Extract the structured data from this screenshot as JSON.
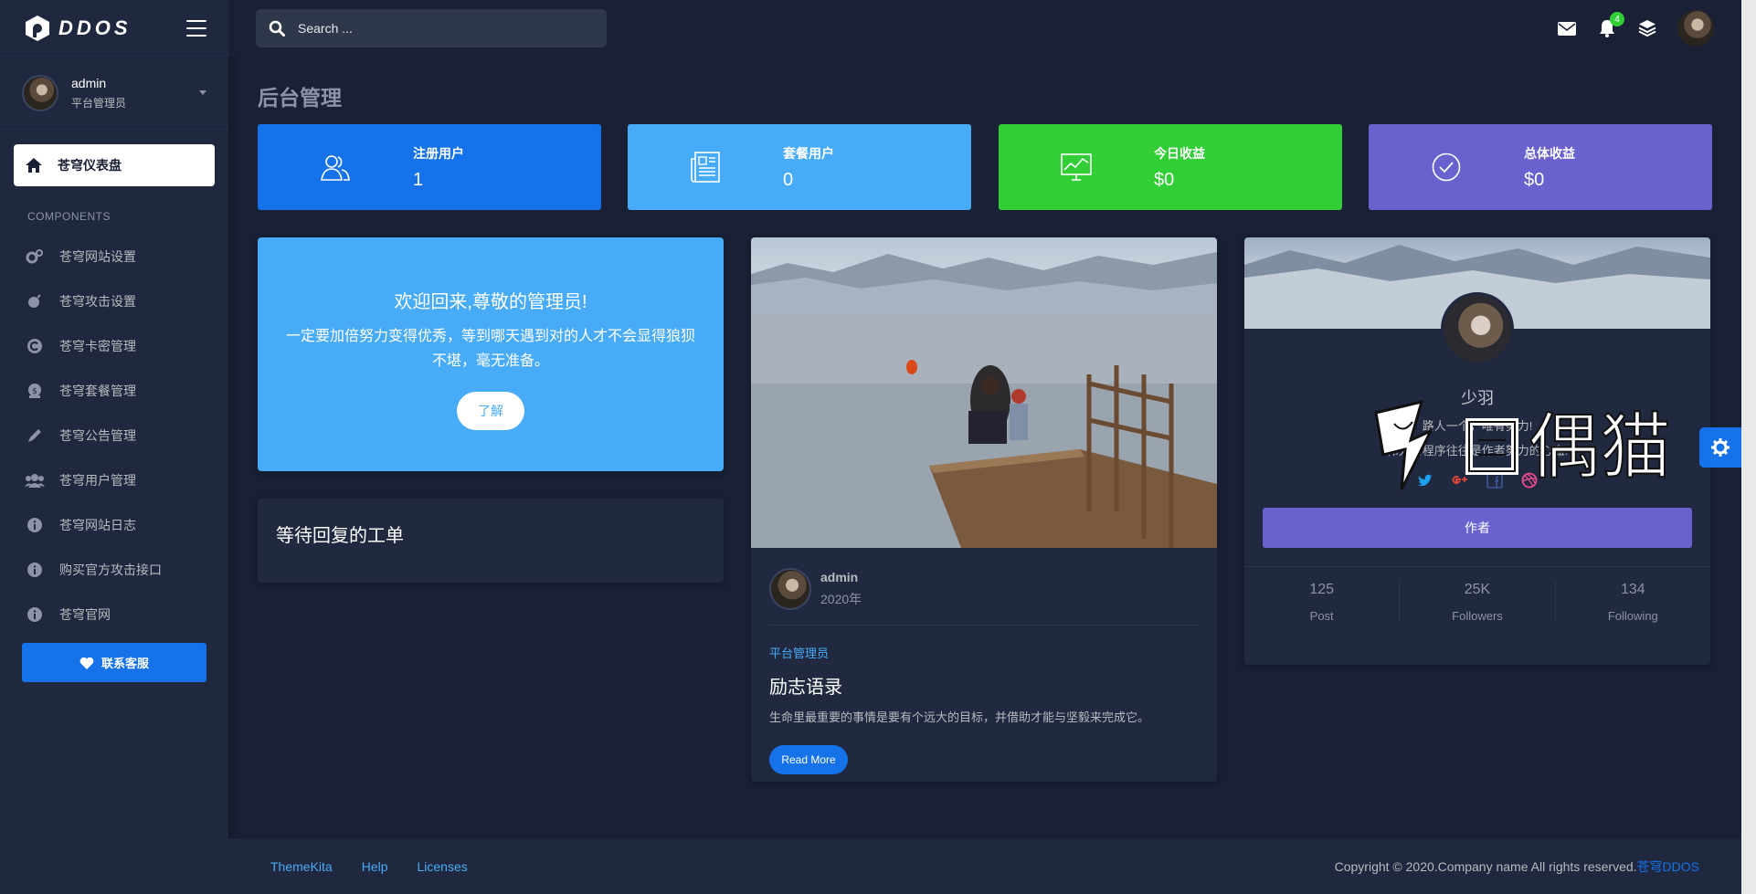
{
  "brand": {
    "logo_text": "DDOS"
  },
  "sidebar": {
    "user": {
      "name": "admin",
      "role": "平台管理员"
    },
    "active_item": {
      "label": "苍穹仪表盘",
      "icon": "home-icon"
    },
    "section_label": "COMPONENTS",
    "items": [
      {
        "label": "苍穹网站设置",
        "icon": "gears-icon"
      },
      {
        "label": "苍穹攻击设置",
        "icon": "bomb-icon"
      },
      {
        "label": "苍穹卡密管理",
        "icon": "copyright-icon"
      },
      {
        "label": "苍穹套餐管理",
        "icon": "money-bag-icon"
      },
      {
        "label": "苍穹公告管理",
        "icon": "pen-icon"
      },
      {
        "label": "苍穹用户管理",
        "icon": "users-icon"
      },
      {
        "label": "苍穹网站日志",
        "icon": "info-icon"
      },
      {
        "label": "购买官方攻击接口",
        "icon": "info-icon"
      },
      {
        "label": "苍穹官网",
        "icon": "info-icon"
      }
    ],
    "contact_button": "联系客服"
  },
  "topbar": {
    "search_placeholder": "Search ...",
    "notification_count": "4"
  },
  "page": {
    "title": "后台管理"
  },
  "stats": [
    {
      "label": "注册用户",
      "value": "1",
      "color": "#1572e8",
      "icon": "users-outline-icon"
    },
    {
      "label": "套餐用户",
      "value": "0",
      "color": "#48abf7",
      "icon": "newspaper-icon"
    },
    {
      "label": "今日收益",
      "value": "$0",
      "color": "#31ce36",
      "icon": "chart-monitor-icon"
    },
    {
      "label": "总体收益",
      "value": "$0",
      "color": "#6861ce",
      "icon": "check-circle-icon"
    }
  ],
  "welcome": {
    "title": "欢迎回来,尊敬的管理员!",
    "text": "一定要加倍努力变得优秀，等到哪天遇到对的人才不会显得狼狈不堪，毫无准备。",
    "button": "了解"
  },
  "tickets": {
    "title": "等待回复的工单"
  },
  "blog": {
    "author": "admin",
    "date": "2020年",
    "category": "平台管理员",
    "title": "励志语录",
    "text": "生命里最重要的事情是要有个远大的目标，并借助才能与坚毅来完成它。",
    "button": "Read More"
  },
  "profile": {
    "name": "少羽",
    "line1": "路人一个，唯有努力!",
    "line2": "伟大的程序往往是作者努力的心血!",
    "button": "作者",
    "stats": [
      {
        "value": "125",
        "label": "Post"
      },
      {
        "value": "25K",
        "label": "Followers"
      },
      {
        "value": "134",
        "label": "Following"
      }
    ]
  },
  "watermark": {
    "text": "偶猫"
  },
  "footer": {
    "links": [
      "ThemeKita",
      "Help",
      "Licenses"
    ],
    "copyright": "Copyright © 2020.Company name All rights reserved.",
    "brand": "苍穹DDOS"
  }
}
